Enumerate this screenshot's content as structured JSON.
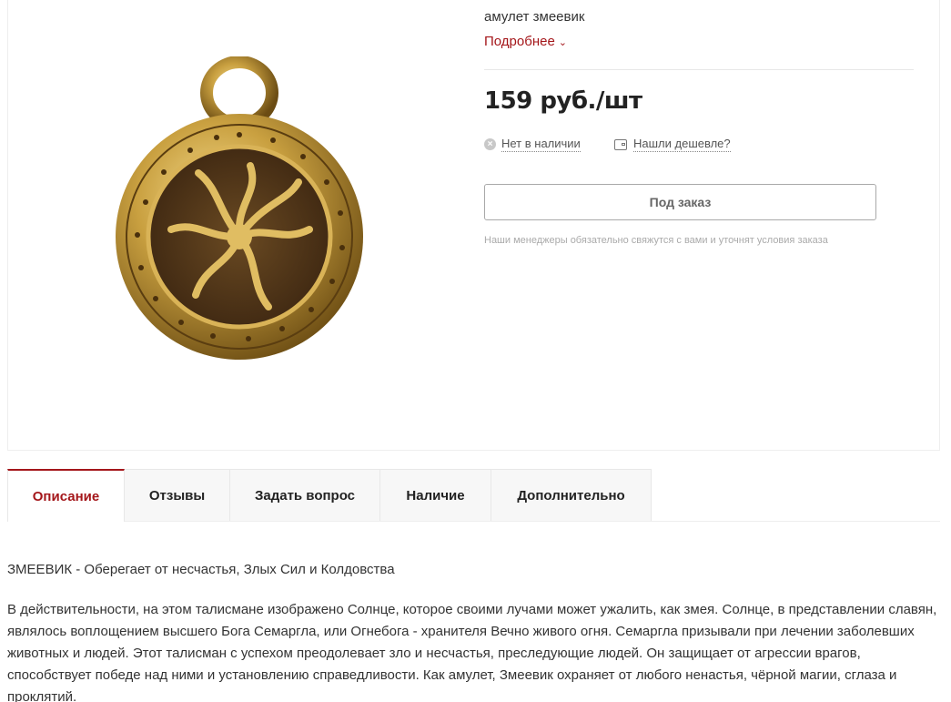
{
  "product": {
    "short_description": "амулет змеевик",
    "more_link": "Подробнее",
    "price": "159 руб./шт",
    "stock_status": "Нет в наличии",
    "cheaper_link": "Нашли дешевле?",
    "order_button": "Под заказ",
    "manager_note": "Наши менеджеры обязательно свяжутся с вами и уточнят условия заказа"
  },
  "tabs": [
    {
      "label": "Описание",
      "active": true
    },
    {
      "label": "Отзывы",
      "active": false
    },
    {
      "label": "Задать вопрос",
      "active": false
    },
    {
      "label": "Наличие",
      "active": false
    },
    {
      "label": "Дополнительно",
      "active": false
    }
  ],
  "description": {
    "title": "ЗМЕЕВИК - Оберегает от несчастья, Злых Сил и Колдовства",
    "body": "В действительности, на этом талисмане изображено Солнце, которое своими лучами может ужалить, как змея. Солнце, в представлении славян, являлось воплощением высшего Бога Семаргла, или Огнебога - хранителя Вечно живого огня. Семаргла призывали при лечении заболевших животных и людей. Этот талисман с успехом преодолевает зло и несчастья, преследующие людей. Он защищает от агрессии врагов, способствует победе над ними и установлению справедливости. Как амулет, Змеевик охраняет от любого ненастья, чёрной магии, сглаза и проклятий."
  },
  "colors": {
    "accent": "#a4161a",
    "text": "#333333",
    "muted": "#aaaaaa"
  },
  "icons": {
    "stock": "x-circle-icon",
    "cheaper": "wallet-icon",
    "more": "chevron-down-icon"
  }
}
